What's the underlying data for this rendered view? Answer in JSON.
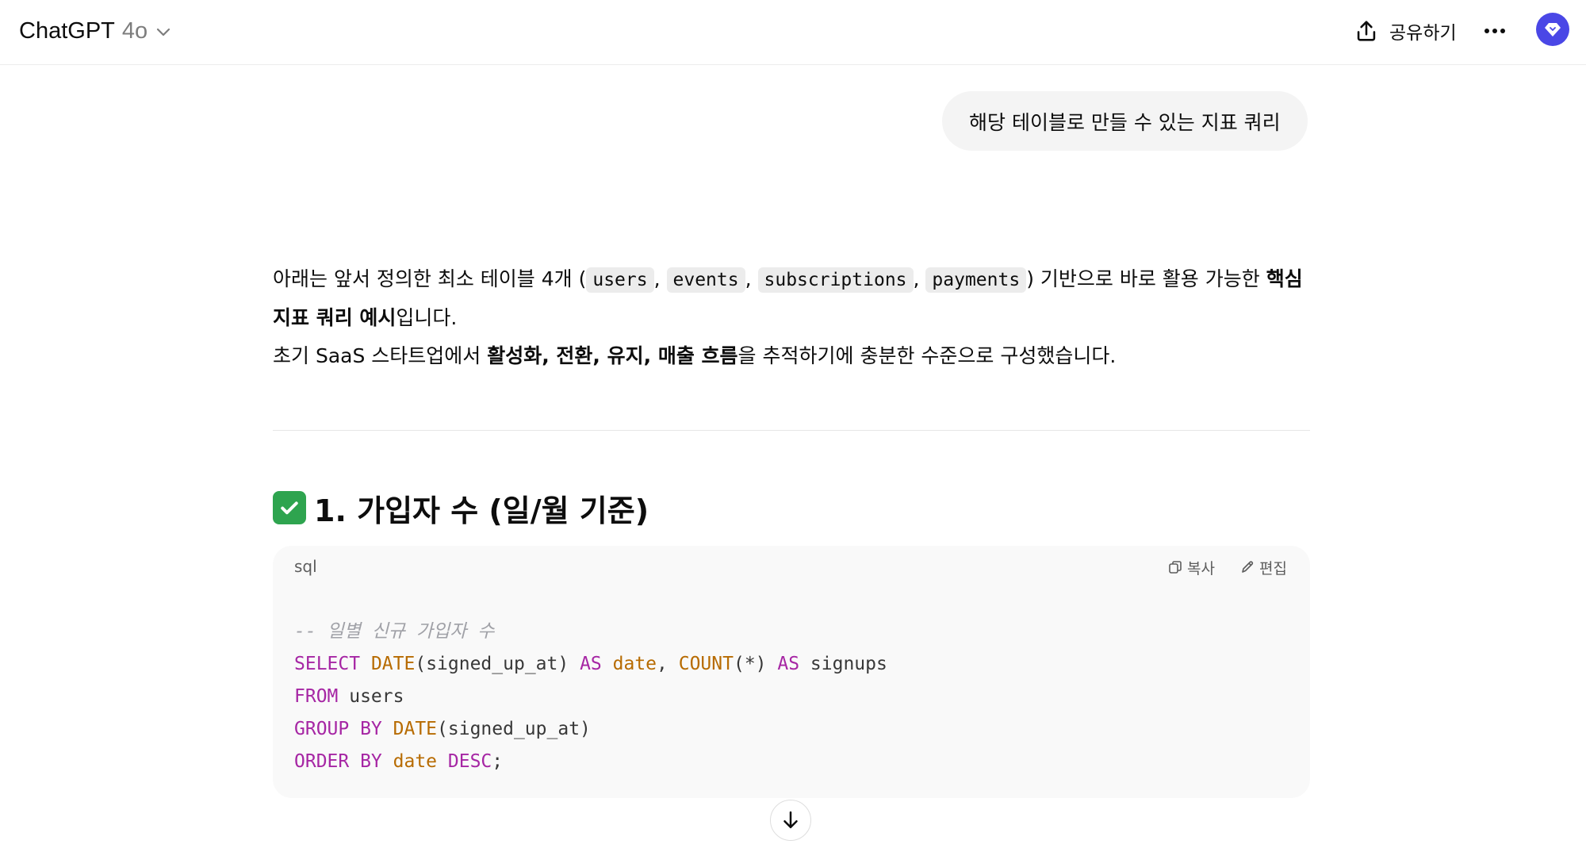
{
  "header": {
    "app_name": "ChatGPT",
    "model_version": "4o",
    "share_label": "공유하기"
  },
  "user_message": "해당 테이블로 만들 수 있는 지표 쿼리",
  "answer": {
    "intro_prefix": "아래는 앞서 정의한 최소 테이블 4개 (",
    "tables": [
      "users",
      "events",
      "subscriptions",
      "payments"
    ],
    "intro_after_tables": ") 기반으로 바로 활용 가능한 ",
    "intro_bold": "핵심 지표 쿼리 예시",
    "intro_end": "입니다.",
    "line2_prefix": "초기 SaaS 스타트업에서 ",
    "line2_bold": "활성화, 전환, 유지, 매출 흐름",
    "line2_end": "을 추적하기에 충분한 수준으로 구성했습니다."
  },
  "section1": {
    "heading": "1. 가입자 수 (일/월 기준)"
  },
  "code_block": {
    "language": "sql",
    "copy_label": "복사",
    "edit_label": "편집",
    "comment": "-- 일별 신규 가입자 수",
    "tokens": {
      "select": "SELECT",
      "date_fn": "DATE",
      "arg1": "(signed_up_at) ",
      "as1": "AS",
      "alias_date": "date",
      "comma": ", ",
      "count_fn": "COUNT",
      "count_arg": "(*) ",
      "as2": "AS",
      "alias_signups": " signups",
      "from": "FROM",
      "table": " users",
      "group_by": "GROUP BY",
      "date_fn2": "DATE",
      "arg2": "(signed_up_at)",
      "order_by": "ORDER BY",
      "order_col": "date",
      "desc": "DESC",
      "semicolon": ";"
    }
  },
  "icons": {
    "chevron": "chevron-down-icon",
    "share": "share-upload-icon",
    "more": "more-dots-icon",
    "avatar": "diamond-avatar-icon",
    "copy": "copy-icon",
    "edit": "pencil-icon",
    "scroll": "arrow-down-icon",
    "check": "check-mark-emoji"
  },
  "colors": {
    "avatar_bg": "#4a47e6",
    "keyword": "#a626a4",
    "function": "#b76b01",
    "comment": "#a0a1a7",
    "check_bg": "#2ea44f"
  }
}
